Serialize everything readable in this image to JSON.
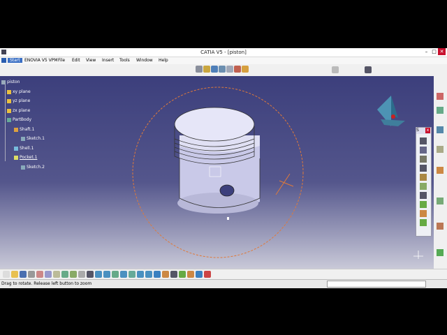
{
  "window": {
    "title": "CATIA V5 - [piston]",
    "min": "–",
    "max": "□",
    "close": "✕"
  },
  "menu": {
    "start": "Start",
    "enovia": "ENOVIA V5 VPM",
    "file": "File",
    "edit": "Edit",
    "view": "View",
    "insert": "Insert",
    "tools": "Tools",
    "window": "Window",
    "help": "Help"
  },
  "tree": {
    "root": "piston",
    "xy": "xy plane",
    "yz": "yz plane",
    "zx": "zx plane",
    "partbody": "PartBody",
    "shaft": "Shaft.1",
    "sketch1": "Sketch.1",
    "shell": "Shell.1",
    "pocket": "Pocket.1",
    "sketch2": "Sketch.2"
  },
  "float_toolbar": {
    "title": "S",
    "close": "x"
  },
  "status": {
    "message": "Drag to rotate. Release left button to zoom"
  },
  "colors": {
    "viewport_top": "#3c3f7c",
    "viewport_bottom": "#c9c9d8",
    "rotate_circle": "#e07a3a",
    "piston": "#dcdcf2"
  }
}
